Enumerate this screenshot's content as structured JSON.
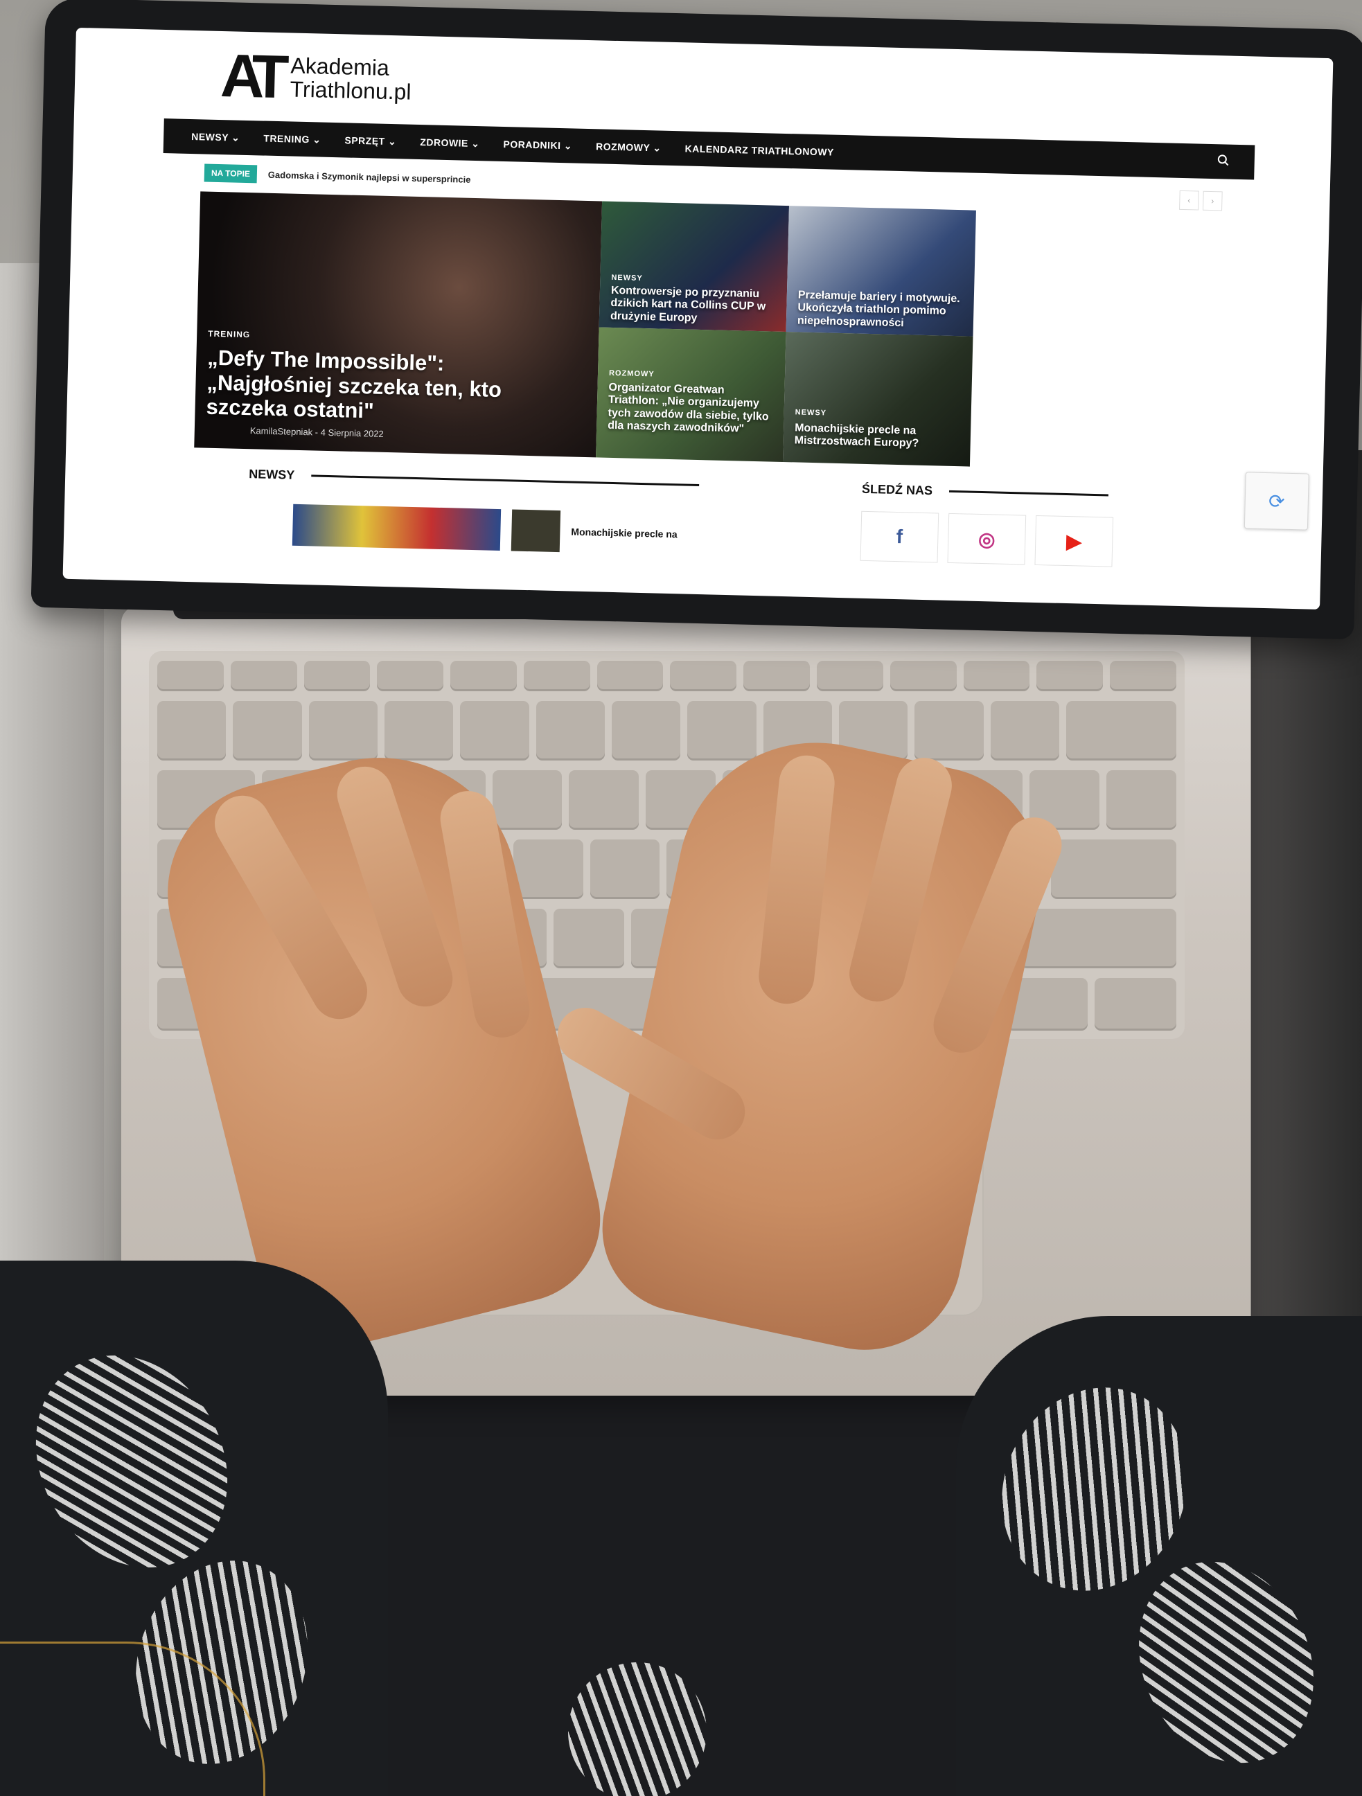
{
  "site": {
    "logo_mark": "AT",
    "logo_line1": "Akademia",
    "logo_line2": "Triathlonu.pl"
  },
  "nav": {
    "items": [
      {
        "label": "NEWSY ⌄"
      },
      {
        "label": "TRENING ⌄"
      },
      {
        "label": "SPRZĘT ⌄"
      },
      {
        "label": "ZDROWIE ⌄"
      },
      {
        "label": "PORADNIKI ⌄"
      },
      {
        "label": "ROZMOWY ⌄"
      },
      {
        "label": "KALENDARZ TRIATHLONOWY"
      }
    ],
    "search_icon": "search-icon"
  },
  "ticker": {
    "badge": "NA TOPIE",
    "headline": "Gadomska i Szymonik najlepsi w supersprincie"
  },
  "featured": {
    "category": "TRENING",
    "title": "„Defy The Impossible\": „Najgłośniej szczeka ten, kto szczeka ostatni\"",
    "author": "KamilaStepniak",
    "date": "4 Sierpnia 2022"
  },
  "tiles": [
    {
      "category": "NEWSY",
      "title": "Kontrowersje po przyznaniu dzikich kart na Collins CUP w drużynie Europy"
    },
    {
      "category": "",
      "title": "Przełamuje bariery i motywuje. Ukończyła triathlon pomimo niepełnosprawności"
    },
    {
      "category": "ROZMOWY",
      "title": "Organizator Greatwan Triathlon: „Nie organizujemy tych zawodów dla siebie, tylko dla naszych zawodników\""
    },
    {
      "category": "NEWSY",
      "title": "Monachijskie precle na Mistrzostwach Europy?"
    }
  ],
  "sections": {
    "newsy": "NEWSY",
    "follow": "ŚLEDŹ NAS",
    "teaser": "Monachijskie precle na"
  },
  "social": {
    "facebook": "f",
    "instagram": "◎",
    "youtube": "▶"
  },
  "colors": {
    "accent": "#22a99a",
    "nav_bg": "#121212"
  }
}
